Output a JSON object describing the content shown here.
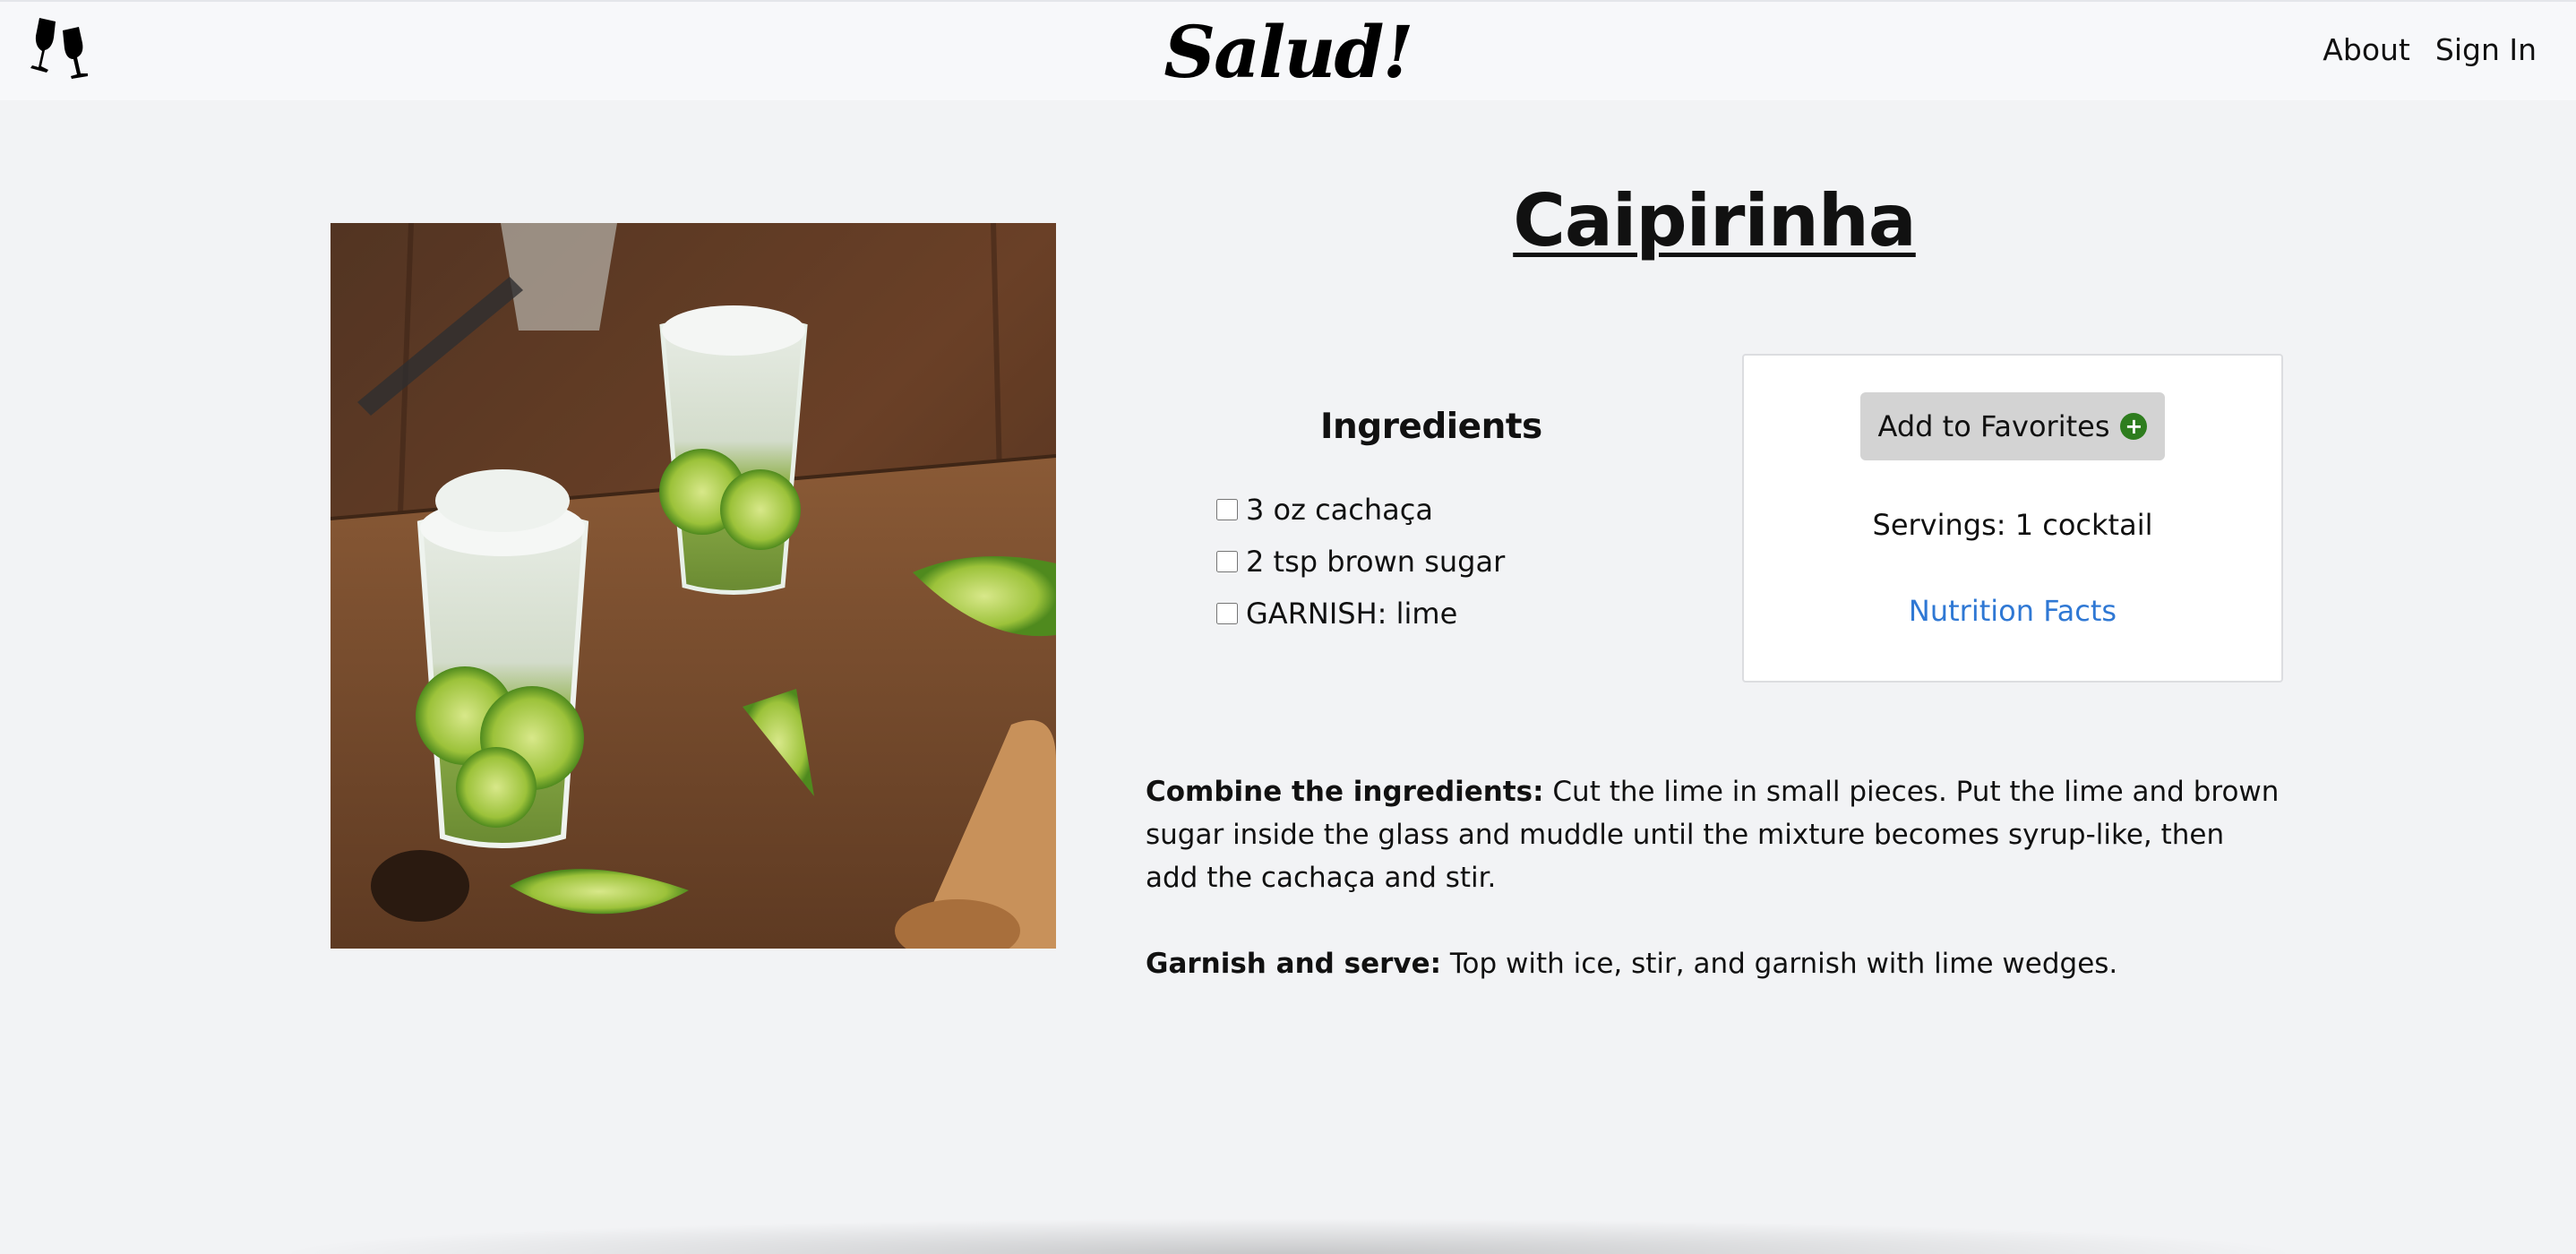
{
  "header": {
    "brand": "Salud!",
    "logo_icon": "clinking-wine-glasses-icon",
    "nav": [
      {
        "label": "About"
      },
      {
        "label": "Sign In"
      }
    ]
  },
  "drink": {
    "name": "Caipirinha",
    "image_alt": "caipirinha-cocktail-photo"
  },
  "ingredients": {
    "heading": "Ingredients",
    "items": [
      {
        "label": "3 oz cachaça",
        "checked": false
      },
      {
        "label": "2 tsp brown sugar",
        "checked": false
      },
      {
        "label": "GARNISH: lime",
        "checked": false
      }
    ]
  },
  "card": {
    "favorites_label": "Add to Favorites",
    "favorites_icon": "plus-circle-icon",
    "servings": "Servings: 1 cocktail",
    "nutrition_link": "Nutrition Facts"
  },
  "instructions": [
    {
      "label": "Combine the ingredients:",
      "text": " Cut the lime in small pieces. Put the lime and brown sugar inside the glass and muddle until the mixture becomes syrup-like, then add the cachaça and stir."
    },
    {
      "label": "Garnish and serve:",
      "text": " Top with ice, stir, and garnish with lime wedges."
    }
  ],
  "colors": {
    "background": "#f2f3f5",
    "navbar": "#f7f8fa",
    "link": "#2f78d4",
    "favorites_button": "#d3d3d3",
    "plus_icon": "#2e7d1e"
  }
}
